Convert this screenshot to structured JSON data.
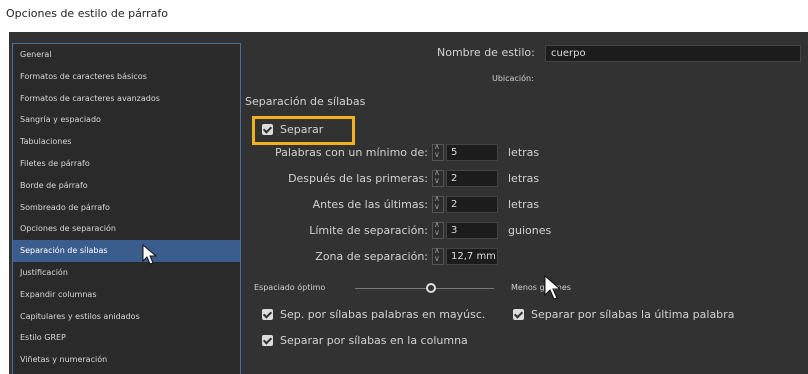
{
  "window": {
    "title": "Opciones de estilo de párrafo"
  },
  "sidebar": {
    "items": [
      {
        "label": "General"
      },
      {
        "label": "Formatos de caracteres básicos"
      },
      {
        "label": "Formatos de caracteres avanzados"
      },
      {
        "label": "Sangría y espaciado"
      },
      {
        "label": "Tabulaciones"
      },
      {
        "label": "Filetes de párrafo"
      },
      {
        "label": "Borde de párrafo"
      },
      {
        "label": "Sombreado de párrafo"
      },
      {
        "label": "Opciones de separación"
      },
      {
        "label": "Separación de sílabas",
        "selected": true
      },
      {
        "label": "Justificación"
      },
      {
        "label": "Expandir columnas"
      },
      {
        "label": "Capitulares y estilos anidados"
      },
      {
        "label": "Estilo GREP"
      },
      {
        "label": "Viñetas y numeración"
      }
    ]
  },
  "main": {
    "style_name_label": "Nombre de estilo:",
    "style_name_value": "cuerpo",
    "location_label": "Ubicación:",
    "section_title": "Separación de sílabas",
    "separar": {
      "label": "Separar",
      "checked": true
    },
    "fields": [
      {
        "label": "Palabras con un mínimo de:",
        "value": "5",
        "unit": "letras"
      },
      {
        "label": "Después de las primeras:",
        "value": "2",
        "unit": "letras"
      },
      {
        "label": "Antes de las últimas:",
        "value": "2",
        "unit": "letras"
      },
      {
        "label": "Límite de separación:",
        "value": "3",
        "unit": "guiones"
      },
      {
        "label": "Zona de separación:",
        "value": "12,7 mm",
        "unit": ""
      }
    ],
    "slider": {
      "left_label": "Espaciado óptimo",
      "right_label": "Menos guiones",
      "value": 0.52
    },
    "checkboxes": [
      {
        "label": "Sep. por sílabas palabras en mayúsc.",
        "checked": true
      },
      {
        "label": "Separar por sílabas la última palabra",
        "checked": true
      },
      {
        "label": "Separar por sílabas en la columna",
        "checked": true
      }
    ]
  },
  "colors": {
    "panel": "#323232",
    "sidebar": "#2a2a2a",
    "selected": "#3a5d8d",
    "highlight": "#f3b21b"
  },
  "icons": {
    "cursor": "mouse-pointer-icon"
  }
}
